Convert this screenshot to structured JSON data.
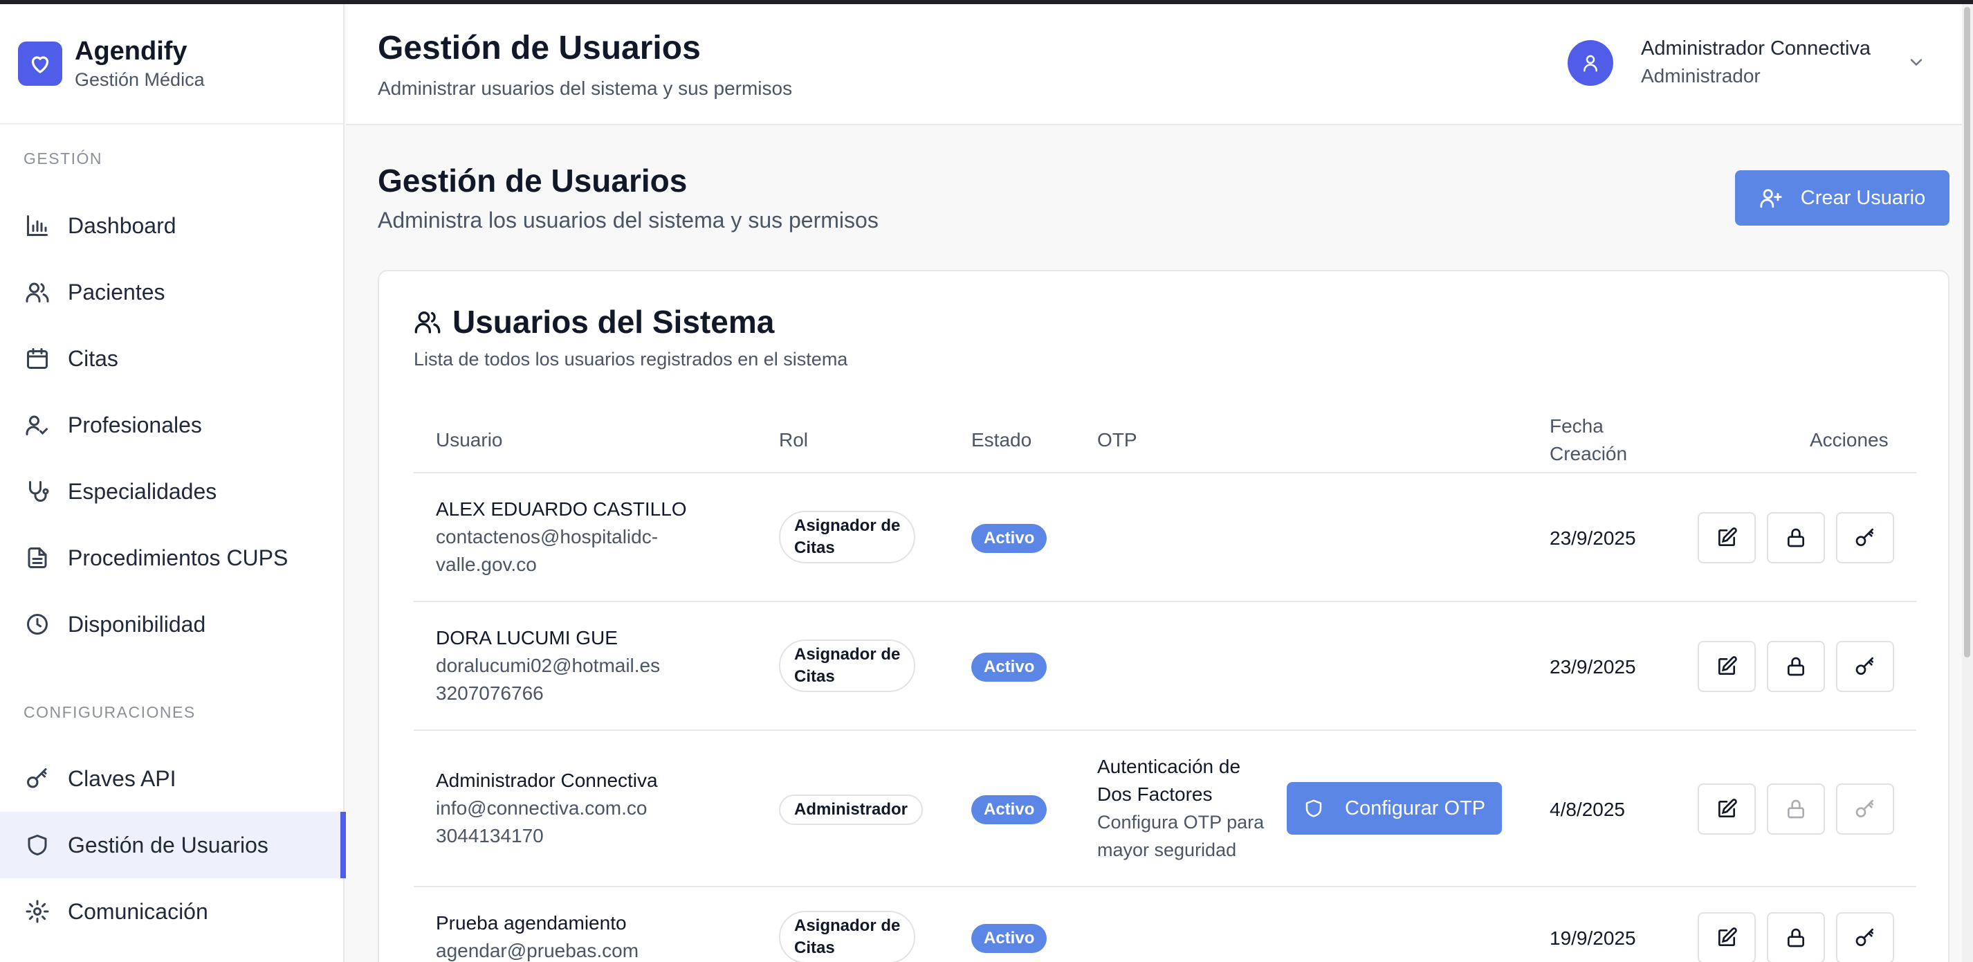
{
  "brand": {
    "title": "Agendify",
    "subtitle": "Gestión Médica"
  },
  "sidebar": {
    "section_gestion": "GESTIÓN",
    "section_config": "CONFIGURACIONES",
    "items": [
      {
        "label": "Dashboard",
        "icon": "bar-chart-icon"
      },
      {
        "label": "Pacientes",
        "icon": "users-icon"
      },
      {
        "label": "Citas",
        "icon": "calendar-icon"
      },
      {
        "label": "Profesionales",
        "icon": "user-check-icon"
      },
      {
        "label": "Especialidades",
        "icon": "stethoscope-icon"
      },
      {
        "label": "Procedimientos CUPS",
        "icon": "file-text-icon"
      },
      {
        "label": "Disponibilidad",
        "icon": "clock-icon"
      }
    ],
    "config_items": [
      {
        "label": "Claves API",
        "icon": "key-icon"
      },
      {
        "label": "Gestión de Usuarios",
        "icon": "shield-icon",
        "active": true
      },
      {
        "label": "Comunicación",
        "icon": "gear-icon"
      }
    ]
  },
  "header": {
    "title": "Gestión de Usuarios",
    "subtitle": "Administrar usuarios del sistema y sus permisos",
    "user_name": "Administrador Connectiva",
    "user_role": "Administrador"
  },
  "main": {
    "title": "Gestión de Usuarios",
    "subtitle": "Administra los usuarios del sistema y sus permisos",
    "create_button": "Crear Usuario",
    "card": {
      "title": "Usuarios del Sistema",
      "subtitle": "Lista de todos los usuarios registrados en el sistema",
      "columns": {
        "usuario": "Usuario",
        "rol": "Rol",
        "estado": "Estado",
        "otp": "OTP",
        "fecha_1": "Fecha",
        "fecha_2": "Creación",
        "acciones": "Acciones"
      },
      "rows": [
        {
          "name": "ALEX EDUARDO CASTILLO",
          "email_1": "contactenos@hospitalidc-",
          "email_2": "valle.gov.co",
          "role_1": "Asignador de",
          "role_2": "Citas",
          "status": "Activo",
          "date": "23/9/2025"
        },
        {
          "name": "DORA LUCUMI GUE",
          "email_1": "doralucumi02@hotmail.es",
          "email_2": "3207076766",
          "role_1": "Asignador de",
          "role_2": "Citas",
          "status": "Activo",
          "date": "23/9/2025"
        },
        {
          "name": "Administrador Connectiva",
          "email_1": "info@connectiva.com.co",
          "email_2": "3044134170",
          "role_1": "Administrador",
          "status": "Activo",
          "otp_title_1": "Autenticación de",
          "otp_title_2": "Dos Factores",
          "otp_desc_1": "Configura OTP para",
          "otp_desc_2": "mayor seguridad",
          "otp_button": "Configurar OTP",
          "date": "4/8/2025"
        },
        {
          "name": "Prueba agendamiento",
          "email_1": "agendar@pruebas.com",
          "role_1": "Asignador de",
          "role_2": "Citas",
          "status": "Activo",
          "date": "19/9/2025"
        }
      ]
    }
  },
  "colors": {
    "accent": "#4f5de8",
    "button": "#5b86e5"
  }
}
